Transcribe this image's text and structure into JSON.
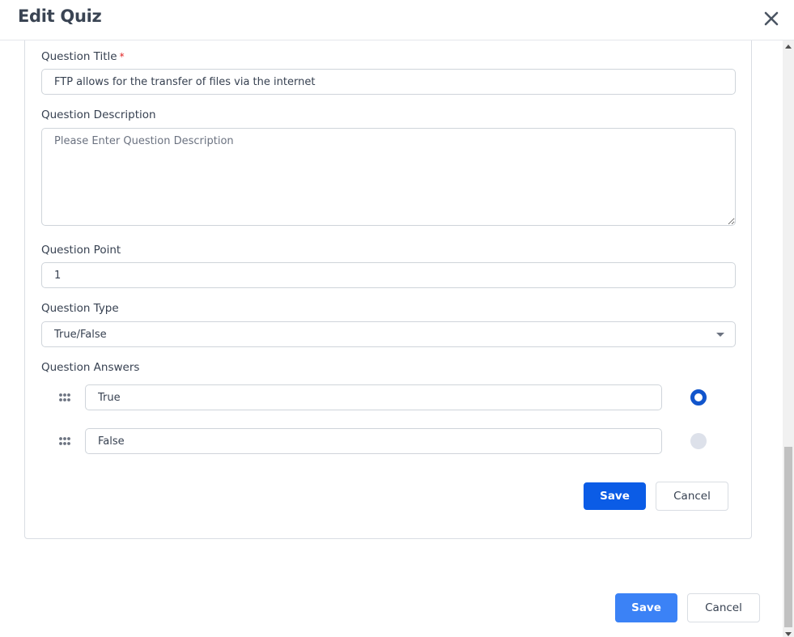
{
  "modal": {
    "title": "Edit Quiz"
  },
  "question_form": {
    "title_label": "Question Title",
    "required_mark": "*",
    "title_value": "FTP allows for the transfer of files via the internet",
    "description_label": "Question Description",
    "description_placeholder": "Please Enter Question Description",
    "description_value": "",
    "point_label": "Question Point",
    "point_value": "1",
    "type_label": "Question Type",
    "type_selected": "True/False",
    "answers_label": "Question Answers",
    "answers": [
      {
        "text": "True",
        "correct": true
      },
      {
        "text": "False",
        "correct": false
      }
    ],
    "save_label": "Save",
    "cancel_label": "Cancel"
  },
  "footer": {
    "save_label": "Save",
    "cancel_label": "Cancel"
  },
  "icons": {
    "close": "close-icon",
    "drag": "drag-handle-icon",
    "caret": "chevron-down-icon"
  },
  "colors": {
    "primary": "#0b5ce6",
    "primary_light": "#3b82f6",
    "radio_selected": "#1155cc",
    "required": "#e02424"
  }
}
